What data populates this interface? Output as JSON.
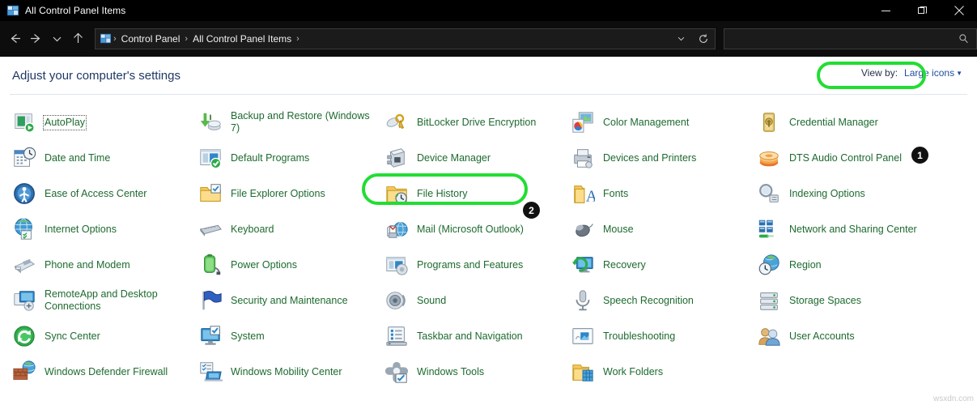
{
  "window": {
    "title": "All Control Panel Items",
    "icon": "control-panel-icon",
    "controls": [
      {
        "name": "minimize",
        "glyph": "minimize-icon"
      },
      {
        "name": "maximize",
        "glyph": "restore-icon"
      },
      {
        "name": "close",
        "glyph": "close-icon"
      }
    ]
  },
  "toolbar": {
    "nav": [
      {
        "name": "back",
        "glyph": "arrow-left-icon"
      },
      {
        "name": "forward",
        "glyph": "arrow-right-icon"
      },
      {
        "name": "recent",
        "glyph": "chevron-down-icon"
      },
      {
        "name": "up",
        "glyph": "arrow-up-icon"
      }
    ],
    "breadcrumbs": [
      "Control Panel",
      "All Control Panel Items"
    ],
    "breadcrumb_separator": "›",
    "address_dropdown": "chevron-down-icon",
    "refresh": "refresh-icon",
    "search": {
      "value": "",
      "placeholder": "",
      "icon": "search-icon"
    }
  },
  "content": {
    "headline": "Adjust your computer's settings",
    "view_by": {
      "label": "View by:",
      "value": "Large icons",
      "caret": "▼"
    }
  },
  "items": [
    {
      "label": "AutoPlay",
      "icon": "autoplay-icon",
      "focused": true
    },
    {
      "label": "Backup and Restore (Windows 7)",
      "icon": "backup-restore-icon",
      "focused": false
    },
    {
      "label": "BitLocker Drive Encryption",
      "icon": "bitlocker-icon",
      "focused": false
    },
    {
      "label": "Color Management",
      "icon": "color-management-icon",
      "focused": false
    },
    {
      "label": "Credential Manager",
      "icon": "credential-manager-icon",
      "focused": false
    },
    {
      "label": "Date and Time",
      "icon": "date-time-icon",
      "focused": false
    },
    {
      "label": "Default Programs",
      "icon": "default-programs-icon",
      "focused": false
    },
    {
      "label": "Device Manager",
      "icon": "device-manager-icon",
      "focused": false
    },
    {
      "label": "Devices and Printers",
      "icon": "devices-printers-icon",
      "focused": false
    },
    {
      "label": "DTS Audio Control Panel",
      "icon": "dts-audio-icon",
      "focused": false
    },
    {
      "label": "Ease of Access Center",
      "icon": "ease-of-access-icon",
      "focused": false
    },
    {
      "label": "File Explorer Options",
      "icon": "file-explorer-options-icon",
      "focused": false
    },
    {
      "label": "File History",
      "icon": "file-history-icon",
      "focused": false
    },
    {
      "label": "Fonts",
      "icon": "fonts-icon",
      "focused": false
    },
    {
      "label": "Indexing Options",
      "icon": "indexing-options-icon",
      "focused": false
    },
    {
      "label": "Internet Options",
      "icon": "internet-options-icon",
      "focused": false
    },
    {
      "label": "Keyboard",
      "icon": "keyboard-icon",
      "focused": false
    },
    {
      "label": "Mail (Microsoft Outlook)",
      "icon": "mail-icon",
      "focused": false
    },
    {
      "label": "Mouse",
      "icon": "mouse-icon",
      "focused": false
    },
    {
      "label": "Network and Sharing Center",
      "icon": "network-sharing-icon",
      "focused": false
    },
    {
      "label": "Phone and Modem",
      "icon": "phone-modem-icon",
      "focused": false
    },
    {
      "label": "Power Options",
      "icon": "power-options-icon",
      "focused": false
    },
    {
      "label": "Programs and Features",
      "icon": "programs-features-icon",
      "focused": false
    },
    {
      "label": "Recovery",
      "icon": "recovery-icon",
      "focused": false
    },
    {
      "label": "Region",
      "icon": "region-icon",
      "focused": false
    },
    {
      "label": "RemoteApp and Desktop Connections",
      "icon": "remoteapp-icon",
      "focused": false
    },
    {
      "label": "Security and Maintenance",
      "icon": "security-maintenance-icon",
      "focused": false
    },
    {
      "label": "Sound",
      "icon": "sound-icon",
      "focused": false
    },
    {
      "label": "Speech Recognition",
      "icon": "speech-recognition-icon",
      "focused": false
    },
    {
      "label": "Storage Spaces",
      "icon": "storage-spaces-icon",
      "focused": false
    },
    {
      "label": "Sync Center",
      "icon": "sync-center-icon",
      "focused": false
    },
    {
      "label": "System",
      "icon": "system-icon",
      "focused": false
    },
    {
      "label": "Taskbar and Navigation",
      "icon": "taskbar-navigation-icon",
      "focused": false
    },
    {
      "label": "Troubleshooting",
      "icon": "troubleshooting-icon",
      "focused": false
    },
    {
      "label": "User Accounts",
      "icon": "user-accounts-icon",
      "focused": false
    },
    {
      "label": "Windows Defender Firewall",
      "icon": "defender-firewall-icon",
      "focused": false
    },
    {
      "label": "Windows Mobility Center",
      "icon": "mobility-center-icon",
      "focused": false
    },
    {
      "label": "Windows Tools",
      "icon": "windows-tools-icon",
      "focused": false
    },
    {
      "label": "Work Folders",
      "icon": "work-folders-icon",
      "focused": false
    }
  ],
  "annotations": [
    {
      "badge": "1",
      "target": "view-by-control"
    },
    {
      "badge": "2",
      "target": "mail-microsoft-outlook-item"
    }
  ],
  "watermark": "wsxdn.com",
  "colors": {
    "titlebar_bg": "#000000",
    "toolbar_bg": "#0d0d0d",
    "item_label": "#1d6a2f",
    "headline": "#1f3864",
    "link": "#1f4e9c",
    "annotation_green": "#22dd33",
    "badge_bg": "#111111"
  }
}
